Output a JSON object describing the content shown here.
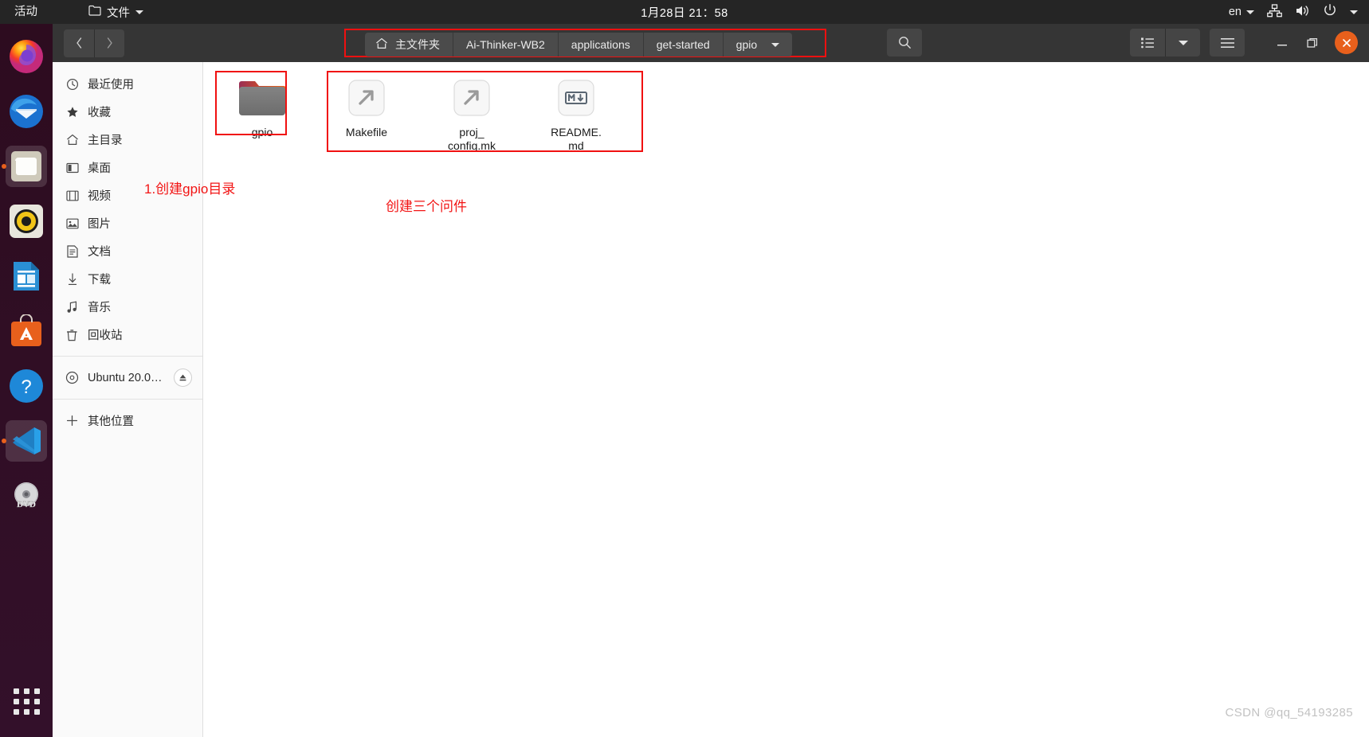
{
  "topbar": {
    "activities": "活动",
    "app_menu": "文件",
    "clock": "1月28日  21：58",
    "language": "en",
    "tray_icons": [
      "network-icon",
      "volume-icon",
      "power-icon",
      "chevron-down-icon"
    ]
  },
  "dock": {
    "items": [
      {
        "name": "firefox",
        "active": false
      },
      {
        "name": "thunderbird",
        "active": false
      },
      {
        "name": "files",
        "active": true
      },
      {
        "name": "rhythmbox",
        "active": false
      },
      {
        "name": "libreoffice-writer",
        "active": false
      },
      {
        "name": "ubuntu-software",
        "active": false
      },
      {
        "name": "help",
        "active": false
      },
      {
        "name": "vscode",
        "active": true
      },
      {
        "name": "dvd-drive",
        "active": false
      }
    ],
    "show_apps": "show-applications"
  },
  "headerbar": {
    "back_label": "‹",
    "forward_label": "›",
    "breadcrumbs": [
      {
        "label": "主文件夹",
        "icon": "home-icon"
      },
      {
        "label": "Ai-Thinker-WB2",
        "icon": ""
      },
      {
        "label": "applications",
        "icon": ""
      },
      {
        "label": "get-started",
        "icon": ""
      },
      {
        "label": "gpio",
        "icon": "chevron-down-icon"
      }
    ],
    "search_icon": "search-icon",
    "view_list_icon": "list-view-icon",
    "view_dropdown_icon": "chevron-down-icon",
    "menu_icon": "hamburger-menu-icon",
    "minimize_icon": "minimize-icon",
    "maximize_icon": "maximize-icon",
    "close_icon": "close-icon"
  },
  "sidebar": {
    "items": [
      {
        "label": "最近使用",
        "icon": "clock-icon"
      },
      {
        "label": "收藏",
        "icon": "star-icon"
      },
      {
        "label": "主目录",
        "icon": "home-icon"
      },
      {
        "label": "桌面",
        "icon": "desktop-icon"
      },
      {
        "label": "视频",
        "icon": "video-icon"
      },
      {
        "label": "图片",
        "icon": "pictures-icon"
      },
      {
        "label": "文档",
        "icon": "documents-icon"
      },
      {
        "label": "下载",
        "icon": "download-icon"
      },
      {
        "label": "音乐",
        "icon": "music-icon"
      },
      {
        "label": "回收站",
        "icon": "trash-icon"
      }
    ],
    "device": {
      "label": "Ubuntu 20.0…",
      "icon": "disc-icon",
      "eject_icon": "eject-icon"
    },
    "other_locations": {
      "label": "其他位置",
      "icon": "plus-icon"
    }
  },
  "files": [
    {
      "name": "gpio",
      "type": "folder",
      "icon": "folder-icon",
      "selected": true
    },
    {
      "name": "Makefile",
      "type": "makefile",
      "icon": "makefile-icon",
      "selected": false
    },
    {
      "name": "proj_\nconfig.mk",
      "type": "makefile",
      "icon": "makefile-icon",
      "selected": false
    },
    {
      "name": "README.\nmd",
      "type": "markdown",
      "icon": "markdown-icon",
      "selected": false
    }
  ],
  "file_labels": {
    "gpio": "gpio",
    "makefile": "Makefile",
    "proj_config_1": "proj_",
    "proj_config_2": "config.mk",
    "readme_1": "README.",
    "readme_2": "md"
  },
  "annotations": [
    {
      "text": "1.创建gpio目录",
      "color": "#f21414"
    },
    {
      "text": "创建三个问件",
      "color": "#f21414"
    }
  ],
  "watermark": "CSDN @qq_54193285",
  "colors": {
    "topbar_bg": "#252525",
    "headerbar_bg": "#353535",
    "dock_bg": "#2d0c1f",
    "accent": "#e8601c",
    "annotation_red": "#f21414",
    "sidebar_bg": "#fafafa"
  }
}
